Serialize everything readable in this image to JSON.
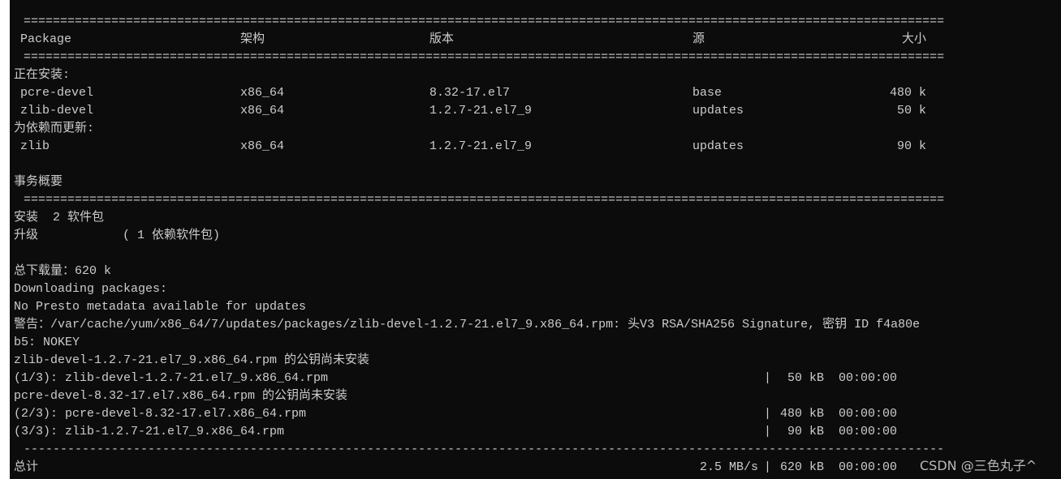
{
  "table": {
    "headers": {
      "package": "Package",
      "arch": "架构",
      "version": "版本",
      "repo": "源",
      "size": "大小"
    },
    "installing_label": "正在安装:",
    "installing": [
      {
        "package": "pcre-devel",
        "arch": "x86_64",
        "version": "8.32-17.el7",
        "repo": "base",
        "size": "480 k"
      },
      {
        "package": "zlib-devel",
        "arch": "x86_64",
        "version": "1.2.7-21.el7_9",
        "repo": "updates",
        "size": "50 k"
      }
    ],
    "dep_update_label": "为依赖而更新:",
    "dep_updates": [
      {
        "package": "zlib",
        "arch": "x86_64",
        "version": "1.2.7-21.el7_9",
        "repo": "updates",
        "size": "90 k"
      }
    ]
  },
  "summary": {
    "title": "事务概要",
    "install": "安装  2 软件包",
    "upgrade_label": "升级",
    "upgrade_value": "( 1 依赖软件包)",
    "total_download": "总下载量：620 k"
  },
  "log": {
    "downloading": "Downloading packages:",
    "presto": "No Presto metadata available for updates",
    "warning1": "警告：/var/cache/yum/x86_64/7/updates/packages/zlib-devel-1.2.7-21.el7_9.x86_64.rpm: 头V3 RSA/SHA256 Signature, 密钥 ID f4a80e",
    "warning2": "b5: NOKEY",
    "nokey1": "zlib-devel-1.2.7-21.el7_9.x86_64.rpm 的公钥尚未安装",
    "nokey2": "pcre-devel-8.32-17.el7.x86_64.rpm 的公钥尚未安装",
    "downloads": [
      {
        "name": "(1/3): zlib-devel-1.2.7-21.el7_9.x86_64.rpm",
        "size": "50 kB",
        "time": "00:00:00"
      },
      {
        "name": "(2/3): pcre-devel-8.32-17.el7.x86_64.rpm",
        "size": "480 kB",
        "time": "00:00:00"
      },
      {
        "name": "(3/3): zlib-1.2.7-21.el7_9.x86_64.rpm",
        "size": "90 kB",
        "time": "00:00:00"
      }
    ],
    "total_label": "总计",
    "total_speed": "2.5 MB/s",
    "total_size": "620 kB",
    "total_time": "00:00:00",
    "bar": "|"
  },
  "watermark": "CSDN @三色丸子^"
}
